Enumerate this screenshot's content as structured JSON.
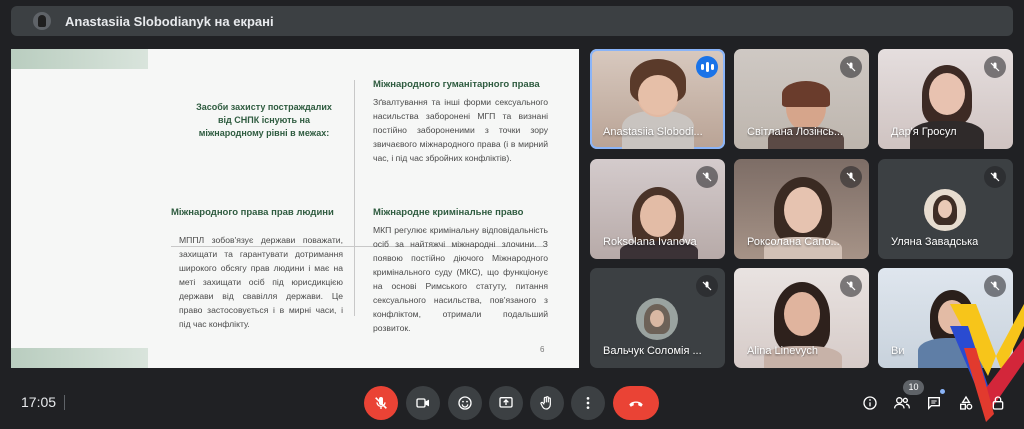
{
  "header": {
    "title": "Anastasiia Slobodianyk на екрані"
  },
  "slide": {
    "center_title": "Засоби захисту постраждалих від СНПК існують на міжнародному рівні в межах:",
    "q1_title": "Міжнародного гуманітарного права",
    "q1_text": "Зґвалтування та інші форми сексуального насильства заборонені МГП та визнані постійно забороненими з точки зору звичаєвого міжнародного права (і в мирний час, і під час збройних конфліктів).",
    "q2_title": "Міжнародного права прав людини",
    "q2_text": "МППЛ зобов'язує держави поважати, захищати та гарантувати дотримання широкого обсягу прав людини і має на меті захищати осіб під юрисдикцією держави від свавілля держави. Це право застосовується і в мирні часи, і під час конфлікту.",
    "q3_title": "Міжнародне кримінальне право",
    "q3_text": "МКП регулює кримінальну відповідальність осіб за найтяжчі міжнародні злочини. З появою постійно діючого Міжнародного кримінального суду (МКС), що функціонує на основі Римського статуту, питання сексуального насильства, пов'язаного з конфліктом, отримали подальший розвиток.",
    "page_num": "6"
  },
  "participants": [
    {
      "name": "Anastasiia Slobodianyk",
      "display": "Anastasiia Slobodi...",
      "speaking": true
    },
    {
      "name": "Світлана Лозінська",
      "display": "Світлана Лозінсь...",
      "muted": true
    },
    {
      "name": "Дар'я Гросул",
      "display": "Дар'я Гросул",
      "muted": true
    },
    {
      "name": "Roksolana Ivanova",
      "display": "Roksolana Ivanova",
      "muted": true
    },
    {
      "name": "Роксолана Сапожник",
      "display": "Роксолана Сапо...",
      "muted": true
    },
    {
      "name": "Уляна Завадська",
      "display": "Уляна Завадська",
      "muted": true
    },
    {
      "name": "Вальчук Соломія",
      "display": "Вальчук Соломія ...",
      "muted": true
    },
    {
      "name": "Alina Linevych",
      "display": "Alina Linevych",
      "muted": true
    },
    {
      "name": "Ви",
      "display": "Ви",
      "muted": true
    }
  ],
  "footer": {
    "time": "17:05",
    "participants_count": "10"
  },
  "colors": {
    "accent": "#1a73e8",
    "danger": "#ea4335",
    "surface": "#3c4043",
    "slide_heading": "#2e5b3f"
  },
  "icons": [
    "pin-icon",
    "mic-off-icon",
    "camera-icon",
    "emoji-icon",
    "present-icon",
    "hand-icon",
    "more-icon",
    "hangup-icon",
    "info-icon",
    "people-icon",
    "chat-icon",
    "activities-icon",
    "lock-icon"
  ]
}
